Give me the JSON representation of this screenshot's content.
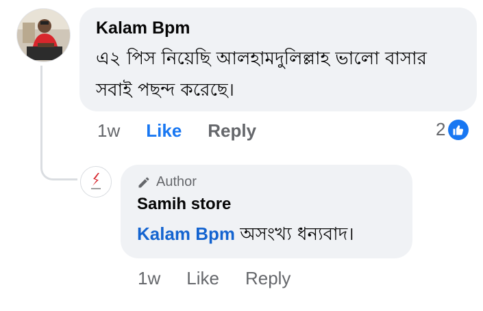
{
  "comment": {
    "author": "Kalam Bpm",
    "text": "এ২ পিস নিয়েছি আলহামদুলিল্লাহ ভালো বাসার সবাই পছন্দ করেছে।",
    "time": "1w",
    "like_label": "Like",
    "reply_label": "Reply",
    "reaction_count": "2",
    "reaction_icon": "thumbs-up-icon",
    "like_state": "liked"
  },
  "reply": {
    "badge_label": "Author",
    "author": "Samih store",
    "mention": "Kalam Bpm",
    "text": "অসংখ্য ধন্যবাদ।",
    "time": "1w",
    "like_label": "Like",
    "reply_label": "Reply"
  },
  "colors": {
    "accent": "#1877f2",
    "bubble": "#f0f2f5",
    "secondary_text": "#65676b"
  }
}
